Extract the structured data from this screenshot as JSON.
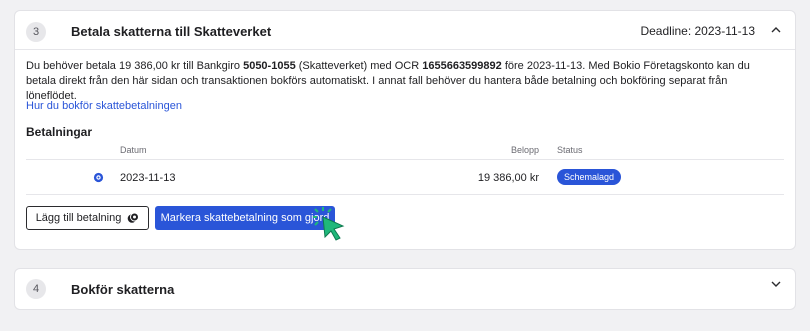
{
  "step3": {
    "number": "3",
    "title": "Betala skatterna till Skatteverket",
    "deadline": "Deadline: 2023-11-13",
    "description": {
      "part1": "Du behöver betala 19 386,00 kr till Bankgiro ",
      "bankgiro": "5050-1055",
      "part2": " (Skatteverket) med OCR ",
      "ocr": "1655663599892",
      "part3": " före 2023-11-13. Med Bokio Företagskonto kan du betala direkt från den här sidan och transaktionen bokförs automatiskt. I annat fall behöver du hantera både betalning och bokföring separat från löneflödet."
    },
    "help_link": "Hur du bokför skattebetalningen",
    "payments": {
      "title": "Betalningar",
      "columns": {
        "date": "Datum",
        "amount": "Belopp",
        "status": "Status"
      },
      "rows": [
        {
          "icon": "coin-icon",
          "date": "2023-11-13",
          "amount": "19 386,00 kr",
          "status": "Schemalagd"
        }
      ]
    },
    "buttons": {
      "add_payment": "Lägg till betalning",
      "mark_paid": "Markera skattebetalning som gjord"
    }
  },
  "step4": {
    "number": "4",
    "title": "Bokför skatterna"
  },
  "colors": {
    "accent": "#2a55d8",
    "background": "#f1f1f3",
    "cursor": "#1fb87a"
  }
}
